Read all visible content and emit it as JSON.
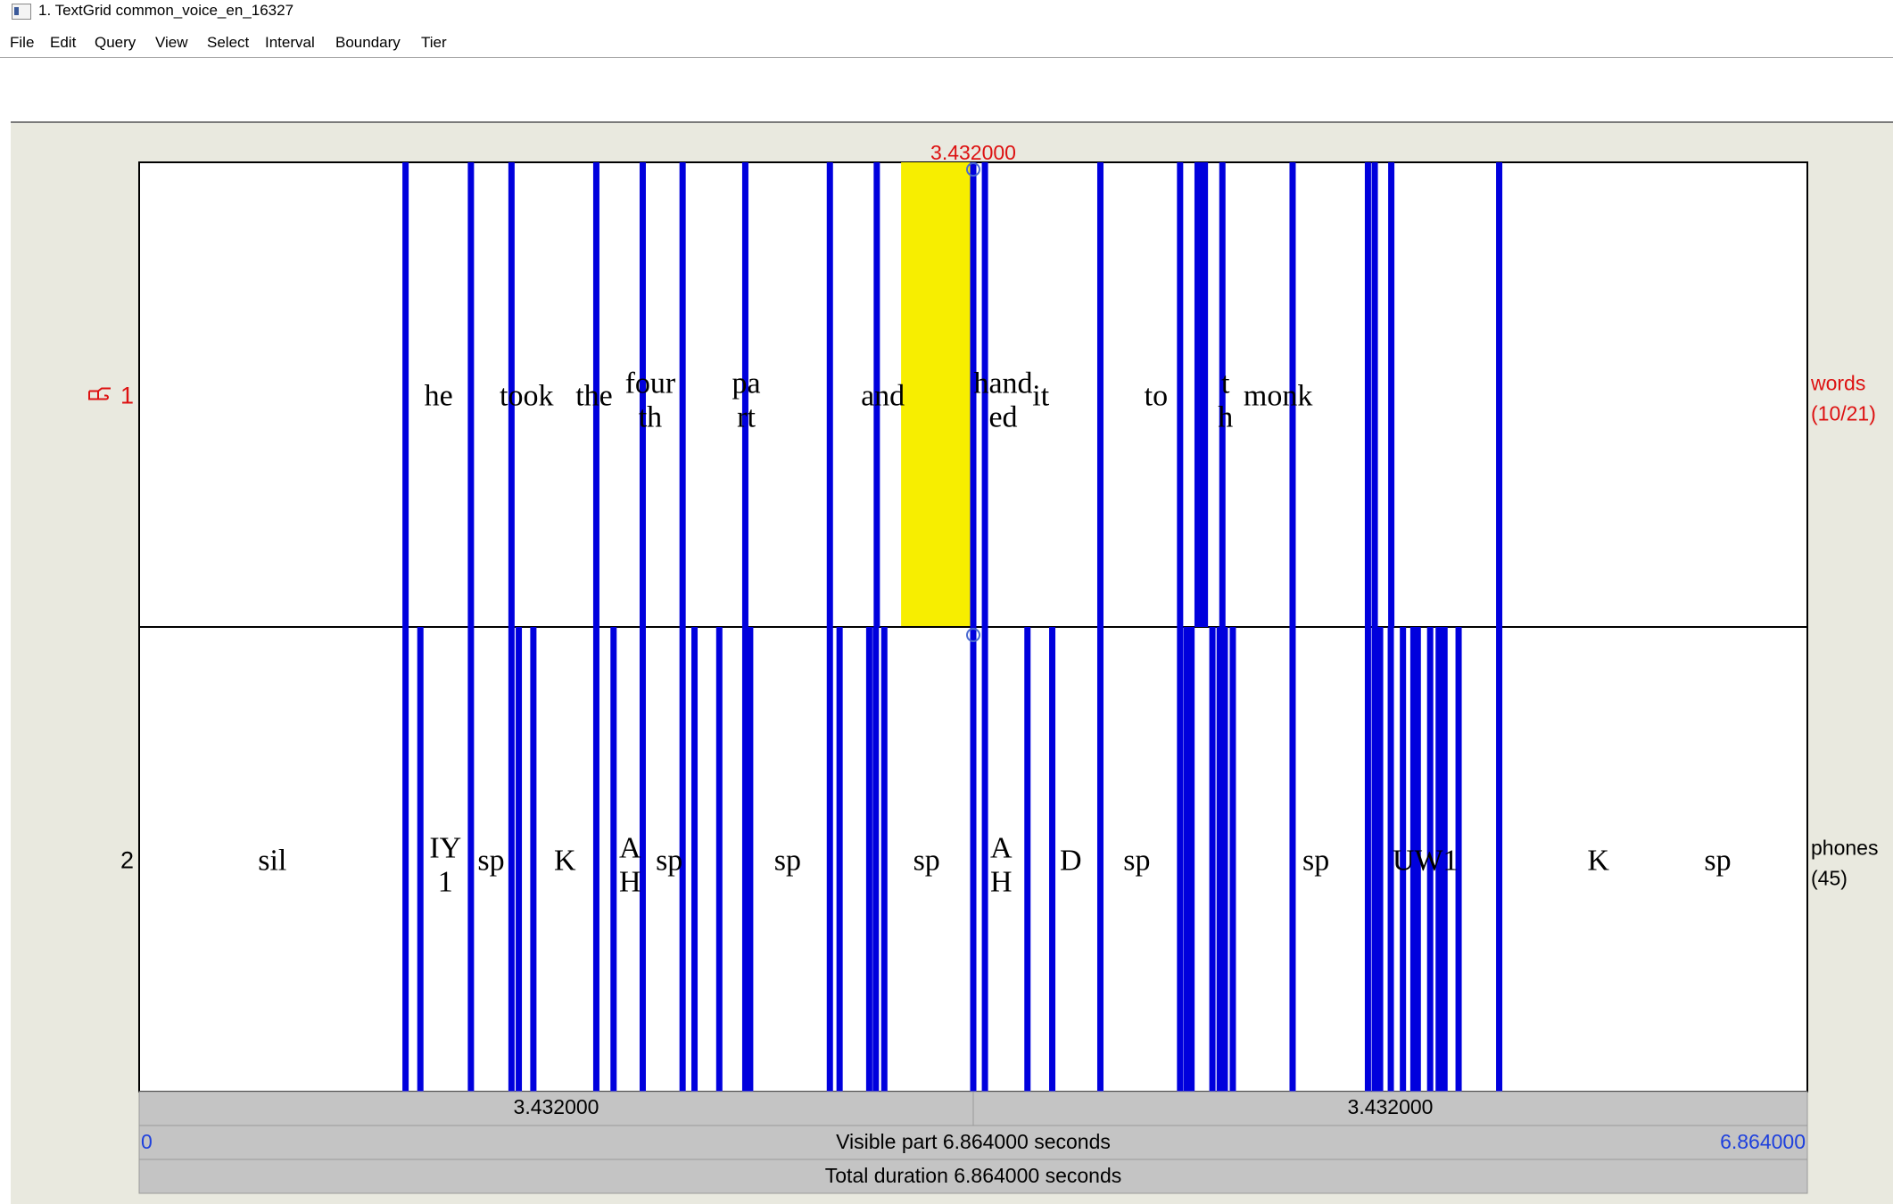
{
  "window": {
    "title": "1. TextGrid common_voice_en_16327"
  },
  "menu": [
    "File",
    "Edit",
    "Query",
    "View",
    "Select",
    "Interval",
    "Boundary",
    "Tier"
  ],
  "colors": {
    "boundary": "#0000dd",
    "selection": "#f7ee00",
    "cursor_label": "#dd1111",
    "time_link": "#1e40dd",
    "bar": "#c4c4c4",
    "panel": "#e9e9df"
  },
  "cursor": {
    "time": 3.432,
    "label": "3.432000"
  },
  "selection": {
    "start": 3.135,
    "end": 3.432,
    "tier": 1
  },
  "view": {
    "start": 0,
    "end": 6.864
  },
  "tiers": [
    {
      "number": "1",
      "selected": true,
      "pointer_icon": "pointing-hand-icon",
      "name": "words",
      "count": "(10/21)",
      "labels": [
        {
          "lines": [
            "he"
          ],
          "time": 1.232
        },
        {
          "lines": [
            "took"
          ],
          "time": 1.594
        },
        {
          "lines": [
            "the"
          ],
          "time": 1.872
        },
        {
          "lines": [
            "four",
            "th"
          ],
          "time": 2.103
        },
        {
          "lines": [
            "pa",
            "rt"
          ],
          "time": 2.498
        },
        {
          "lines": [
            "and"
          ],
          "time": 3.06
        },
        {
          "lines": [
            "hand",
            "ed"
          ],
          "time": 3.555
        },
        {
          "lines": [
            "it"
          ],
          "time": 3.71
        },
        {
          "lines": [
            "to"
          ],
          "time": 4.184
        },
        {
          "lines": [
            "t",
            "h"
          ],
          "time": 4.47
        },
        {
          "lines": [
            "monk"
          ],
          "time": 4.686
        }
      ],
      "boundaries": [
        1.096,
        1.365,
        1.532,
        1.881,
        2.072,
        2.236,
        2.494,
        2.842,
        3.035,
        3.432,
        3.48,
        3.955,
        4.283,
        4.355,
        4.371,
        4.385,
        4.457,
        4.746,
        5.056,
        5.084,
        5.152,
        5.596
      ]
    },
    {
      "number": "2",
      "selected": false,
      "name": "phones",
      "count": "(45)",
      "labels": [
        {
          "lines": [
            "sil"
          ],
          "time": 0.548
        },
        {
          "lines": [
            "IY",
            "1"
          ],
          "time": 1.26
        },
        {
          "lines": [
            "sp"
          ],
          "time": 1.448
        },
        {
          "lines": [
            "K"
          ],
          "time": 1.752
        },
        {
          "lines": [
            "A",
            "H"
          ],
          "time": 2.02
        },
        {
          "lines": [
            "sp"
          ],
          "time": 2.181
        },
        {
          "lines": [
            "sp"
          ],
          "time": 2.668
        },
        {
          "lines": [
            "sp"
          ],
          "time": 3.24
        },
        {
          "lines": [
            "A",
            "H"
          ],
          "time": 3.547
        },
        {
          "lines": [
            "D"
          ],
          "time": 3.833
        },
        {
          "lines": [
            "sp"
          ],
          "time": 4.105
        },
        {
          "lines": [
            "sp"
          ],
          "time": 4.842
        },
        {
          "lines": [
            "UW1"
          ],
          "time": 5.292
        },
        {
          "lines": [
            "K"
          ],
          "time": 6.004
        },
        {
          "lines": [
            "sp"
          ],
          "time": 6.495
        }
      ],
      "boundaries": [
        1.096,
        1.157,
        1.365,
        1.532,
        1.562,
        1.622,
        1.881,
        1.952,
        2.072,
        2.236,
        2.285,
        2.387,
        2.494,
        2.514,
        2.842,
        2.882,
        3.004,
        3.031,
        3.066,
        3.432,
        3.48,
        3.655,
        3.757,
        3.955,
        4.283,
        4.31,
        4.33,
        4.416,
        4.446,
        4.457,
        4.467,
        4.5,
        4.746,
        5.056,
        5.106,
        5.084,
        5.15,
        5.2,
        5.243,
        5.261,
        5.312,
        5.347,
        5.371,
        5.429,
        5.596
      ]
    }
  ],
  "bars": {
    "left_half": "3.432000",
    "right_half": "3.432000",
    "visible_start": "0",
    "visible_label": "Visible part 6.864000 seconds",
    "visible_end": "6.864000",
    "total_label": "Total duration 6.864000 seconds"
  }
}
